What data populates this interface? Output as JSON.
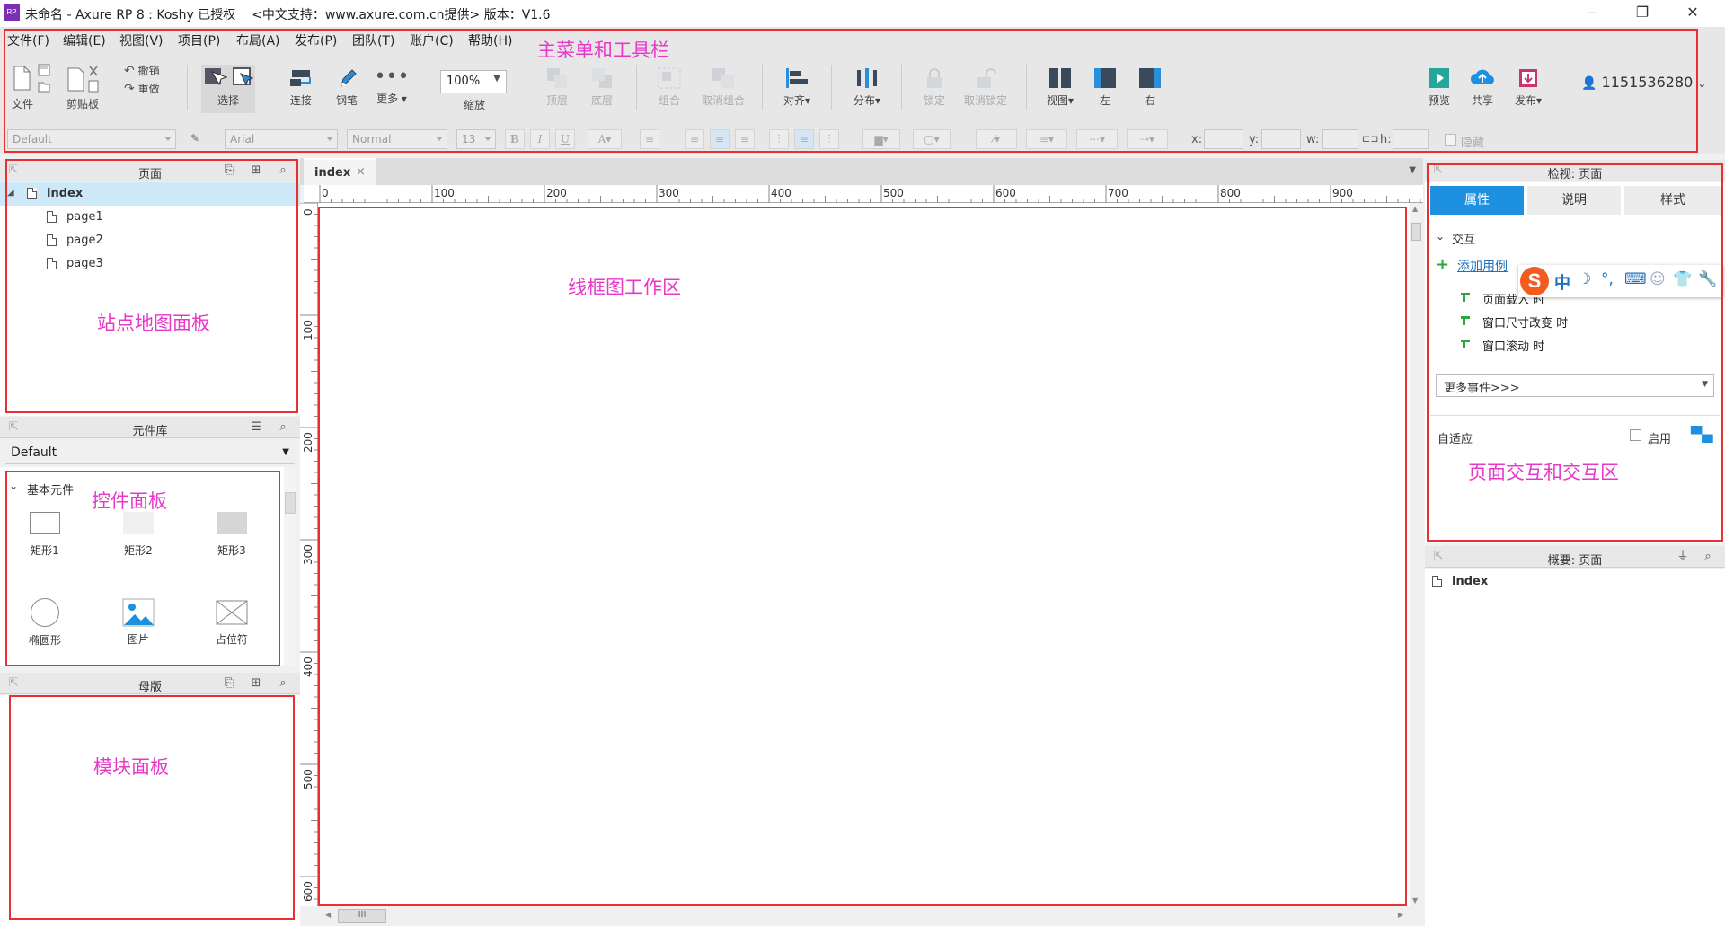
{
  "window": {
    "title": "未命名 - Axure RP 8 : Koshy 已授权    <中文支持：www.axure.com.cn提供> 版本：V1.6",
    "app_icon_text": "RP"
  },
  "menu": [
    "文件(F)",
    "编辑(E)",
    "视图(V)",
    "项目(P)",
    "布局(A)",
    "发布(P)",
    "团队(T)",
    "账户(C)",
    "帮助(H)"
  ],
  "toolbar": {
    "file_label": "文件",
    "clipboard_label": "剪贴板",
    "undo_label": "撤销",
    "redo_label": "重做",
    "select_label": "选择",
    "connect_label": "连接",
    "pen_label": "钢笔",
    "more_label": "更多",
    "zoom_value": "100%",
    "zoom_label": "缩放",
    "top_layer_label": "顶层",
    "bottom_layer_label": "底层",
    "group_label": "组合",
    "ungroup_label": "取消组合",
    "align_label": "对齐",
    "distribute_label": "分布",
    "lock_label": "锁定",
    "unlock_label": "取消锁定",
    "view_label": "视图",
    "left_label": "左",
    "right_label": "右",
    "preview_label": "预览",
    "share_label": "共享",
    "publish_label": "发布",
    "user_id": "1151536280"
  },
  "format_bar": {
    "style_value": "Default",
    "font_value": "Arial",
    "weight_value": "Normal",
    "size_value": "13",
    "bold": "B",
    "italic": "I",
    "underline": "U",
    "x_label": "x:",
    "y_label": "y:",
    "w_label": "w:",
    "h_label": "h:",
    "hidden_label": "隐藏"
  },
  "pages_panel": {
    "title": "页面",
    "root": "index",
    "children": [
      "page1",
      "page2",
      "page3"
    ]
  },
  "library_panel": {
    "title": "元件库",
    "dropdown_value": "Default",
    "section_label": "基本元件",
    "widgets": [
      "矩形1",
      "矩形2",
      "矩形3",
      "椭圆形",
      "图片",
      "占位符"
    ]
  },
  "masters_panel": {
    "title": "母版"
  },
  "canvas": {
    "tab_label": "index",
    "tab_close": "×",
    "h_ruler": [
      "0",
      "100",
      "200",
      "300",
      "400",
      "500",
      "600",
      "700",
      "800",
      "900"
    ],
    "v_ruler": [
      "0",
      "100",
      "200",
      "300",
      "400",
      "500",
      "600"
    ],
    "scroll_thumb": "III"
  },
  "inspector": {
    "title": "检视: 页面",
    "tabs": [
      "属性",
      "说明",
      "样式"
    ],
    "interaction_label": "交互",
    "add_case_label": "添加用例",
    "events": [
      "页面载入 时",
      "窗口尺寸改变 时",
      "窗口滚动 时"
    ],
    "more_events_label": "更多事件>>>",
    "adaptive_label": "自适应",
    "enable_label": "启用"
  },
  "outline_panel": {
    "title": "概要: 页面",
    "item": "index"
  },
  "ime": {
    "zh": "中"
  },
  "annotations": {
    "toolbar": "主菜单和工具栏",
    "sitemap": "站点地图面板",
    "widgets": "控件面板",
    "masters": "模块面板",
    "canvas": "线框图工作区",
    "inspector": "页面交互和交互区"
  },
  "colors": {
    "annotation": "#e838c8",
    "highlight_box": "#e83030",
    "tab_active": "#1e90e0",
    "tree_selected": "#cde8f6"
  }
}
